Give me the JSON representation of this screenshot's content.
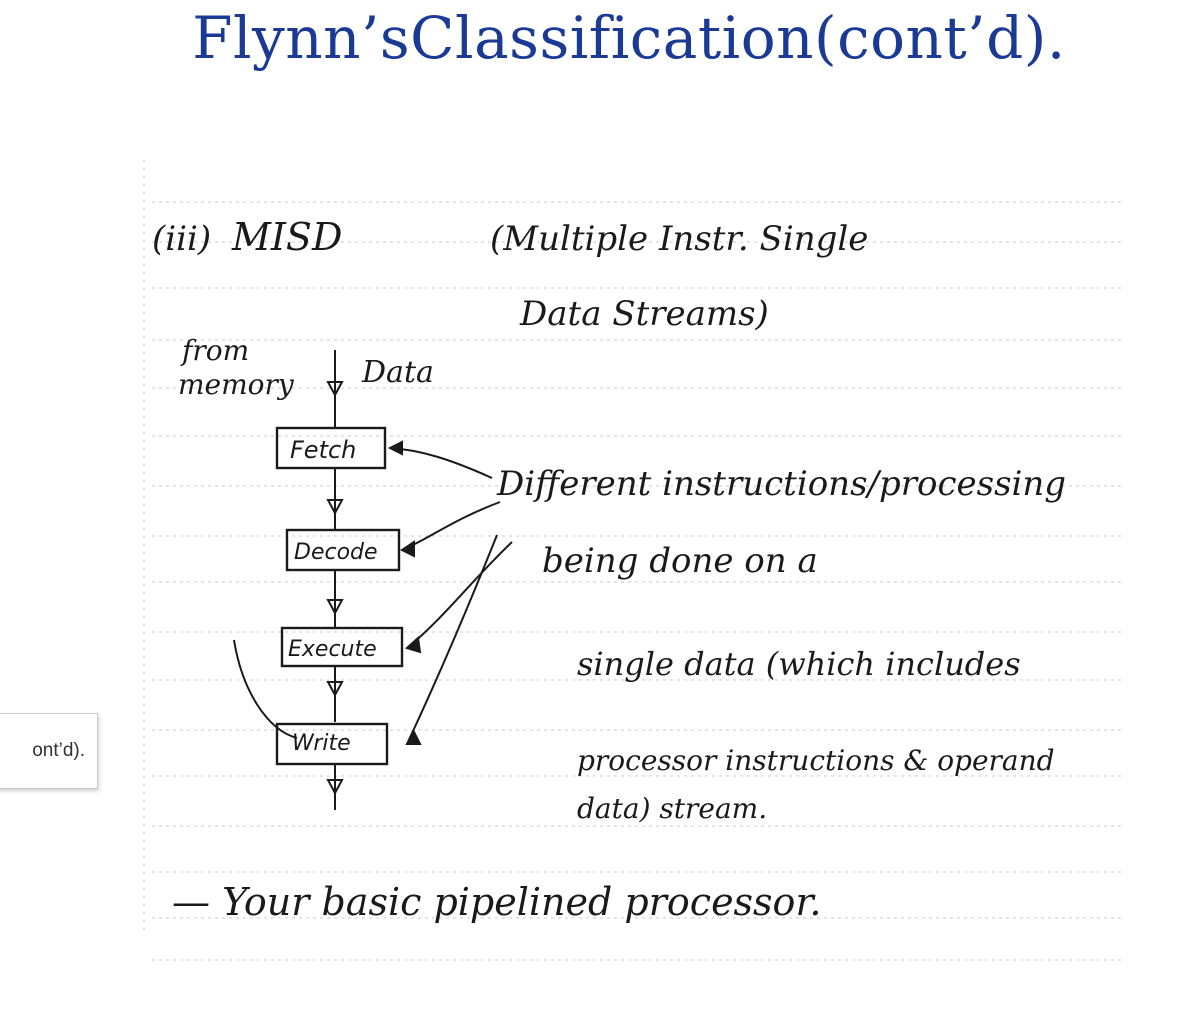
{
  "slide": {
    "title": "Flynn’sClassification(cont’d)."
  },
  "note": {
    "heading_num": "(iii)",
    "heading_abbr": "MISD",
    "heading_desc_line1": "(Multiple Instr. Single",
    "heading_desc_line2": "Data Streams)",
    "input_label_line1": "from",
    "input_label_line2": "memory",
    "input_data": "Data",
    "stages": [
      "Fetch",
      "Decode",
      "Execute",
      "Write"
    ],
    "desc_line1": "Different instructions/processing",
    "desc_line2": "being done on a",
    "desc_line3": "single data (which includes",
    "desc_line4": "processor instructions & operand",
    "desc_line5": "data) stream.",
    "footer": "— Your basic pipelined processor."
  },
  "tooltip": {
    "text": "ont’d)."
  }
}
